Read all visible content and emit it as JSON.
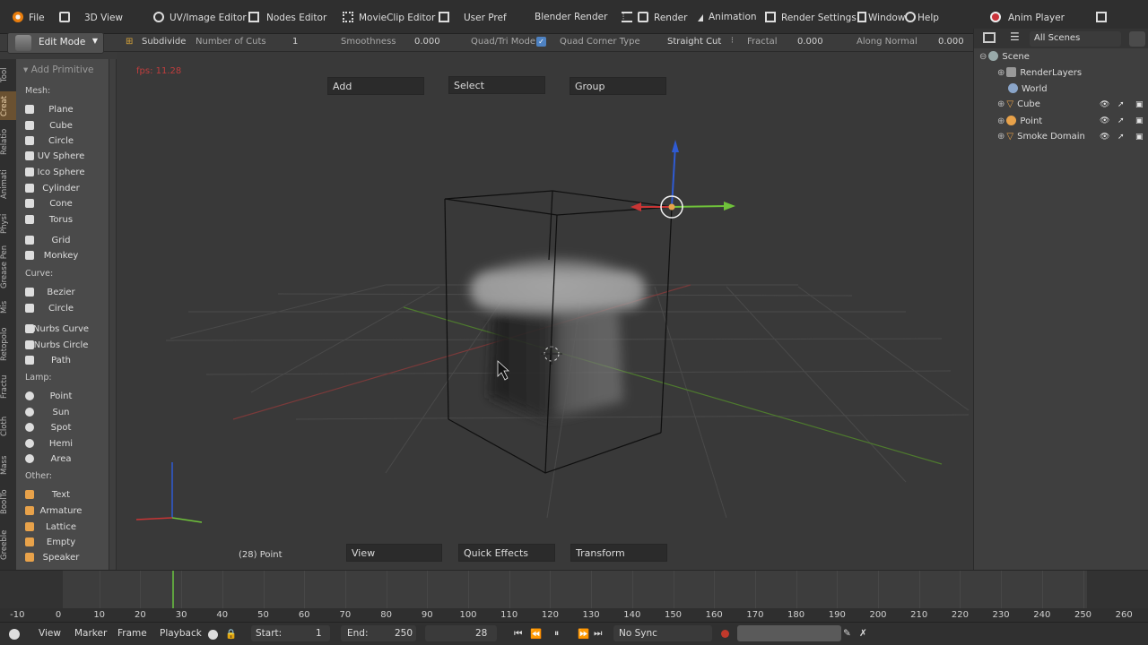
{
  "header": {
    "items": [
      {
        "label": "File",
        "icon": "blender-logo-icon"
      },
      {
        "label": "3D View",
        "icon": "cube-icon"
      },
      {
        "label": "UV/Image Editor",
        "icon": "uv-icon"
      },
      {
        "label": "Nodes Editor",
        "icon": "nodes-icon"
      },
      {
        "label": "MovieClip Editor",
        "icon": "movieclip-icon"
      },
      {
        "label": "User Pref",
        "icon": "prefs-icon"
      },
      {
        "label": "Blender Render",
        "icon": ""
      },
      {
        "label": "Render",
        "icon": "camera-icon"
      },
      {
        "label": "Animation",
        "icon": "animation-icon"
      },
      {
        "label": "Render Settings",
        "icon": "settings-icon"
      },
      {
        "label": "Window",
        "icon": "window-icon"
      },
      {
        "label": "Help",
        "icon": "help-icon"
      },
      {
        "label": "Anim Player",
        "icon": "anim-player-icon"
      }
    ]
  },
  "tool_options": {
    "mode": "Edit Mode",
    "operator": "Subdivide",
    "number_of_cuts_label": "Number of Cuts",
    "number_of_cuts": "1",
    "smoothness_label": "Smoothness",
    "smoothness": "0.000",
    "quad_tri_label": "Quad/Tri Mode",
    "quad_corner_label": "Quad Corner Type",
    "quad_corner_value": "Straight Cut",
    "fractal_label": "Fractal",
    "fractal": "0.000",
    "along_normal_label": "Along Normal",
    "along_normal": "0.000"
  },
  "tabs": [
    "Tool",
    "Creat",
    "Relatio",
    "Animati",
    "Physi",
    "Grease Pen",
    "Mis",
    "Retopolo",
    "Fractu",
    "Cloth",
    "Mass",
    "BoolTo",
    "Greeble"
  ],
  "toolshelf": {
    "title": "Add Primitive",
    "mesh_label": "Mesh:",
    "mesh": [
      "Plane",
      "Cube",
      "Circle",
      "UV Sphere",
      "Ico Sphere",
      "Cylinder",
      "Cone",
      "Torus",
      "Grid",
      "Monkey"
    ],
    "curve_label": "Curve:",
    "curve": [
      "Bezier",
      "Circle",
      "Nurbs Curve",
      "Nurbs Circle",
      "Path"
    ],
    "lamp_label": "Lamp:",
    "lamp": [
      "Point",
      "Sun",
      "Spot",
      "Hemi",
      "Area"
    ],
    "other_label": "Other:",
    "other": [
      "Text",
      "Armature",
      "Lattice",
      "Empty",
      "Speaker"
    ]
  },
  "viewport": {
    "fps": "fps: 11.28",
    "top_menus": [
      "Add",
      "Select",
      "Group"
    ],
    "bottom_menus": [
      "View",
      "Quick Effects",
      "Transform"
    ],
    "status": "(28) Point"
  },
  "outliner": {
    "scenes_dropdown": "All Scenes",
    "items": [
      "Scene",
      "RenderLayers",
      "World",
      "Cube",
      "Point",
      "Smoke Domain"
    ]
  },
  "timeline": {
    "ticks": [
      "-10",
      "0",
      "10",
      "20",
      "30",
      "40",
      "50",
      "60",
      "70",
      "80",
      "90",
      "100",
      "110",
      "120",
      "130",
      "140",
      "150",
      "160",
      "170",
      "180",
      "190",
      "200",
      "210",
      "220",
      "230",
      "240",
      "250",
      "260"
    ],
    "current_frame": 28
  },
  "statusbar": {
    "menus": [
      "View",
      "Marker",
      "Frame",
      "Playback"
    ],
    "start_label": "Start:",
    "start": "1",
    "end_label": "End:",
    "end": "250",
    "current": "28",
    "sync": "No Sync"
  },
  "colors": {
    "accent": "#6a5131",
    "playhead": "#5fa33f",
    "axis_x": "#c93535",
    "axis_y": "#6fc23a",
    "axis_z": "#2f5bd3"
  }
}
